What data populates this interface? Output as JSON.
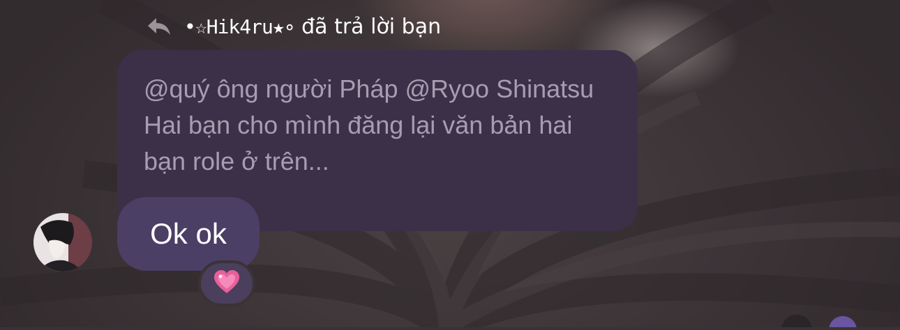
{
  "reply": {
    "icon": "reply-arrow-icon",
    "sender_name": "•☆Hik4ru★∘",
    "action_text": "đã trả lời bạn"
  },
  "quoted_message": {
    "text": "@quý ông người Pháp @Ryoo Shinatsu Hai bạn cho mình đăng lại văn bản hai bạn role ở trên..."
  },
  "message": {
    "text": "Ok ok",
    "reaction_icon": "pink-heart-icon"
  },
  "colors": {
    "quoted_bubble": "#3c3048",
    "message_bubble": "#4b3f65",
    "background": "#3a3336",
    "reaction": "#e8609a"
  }
}
